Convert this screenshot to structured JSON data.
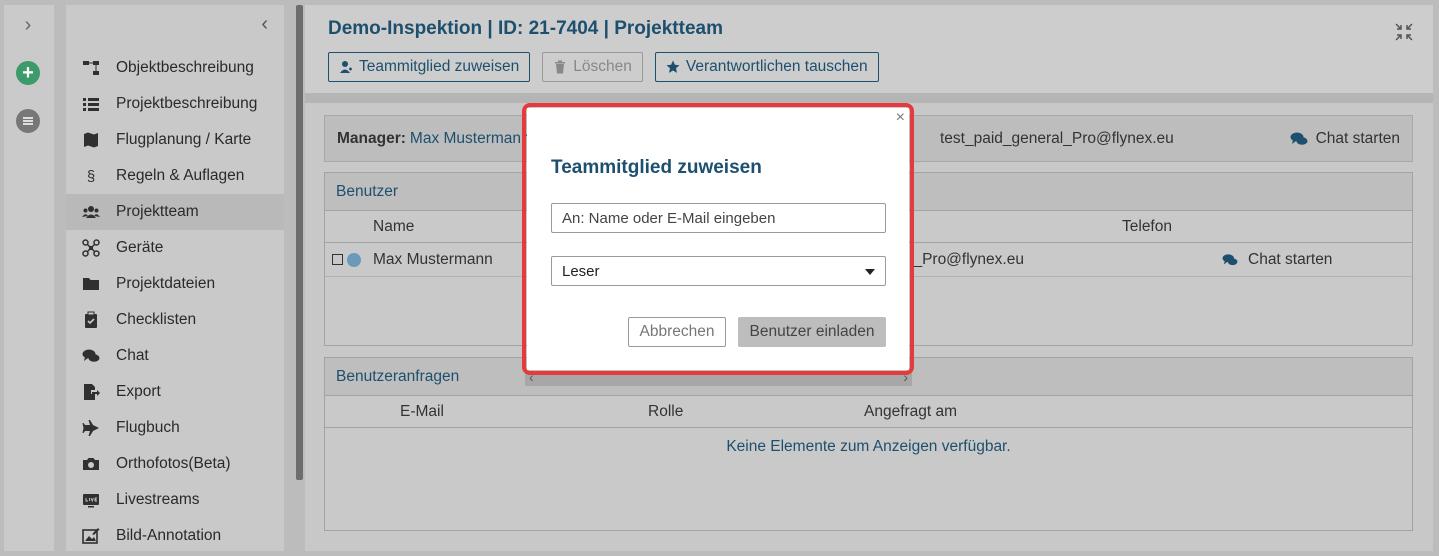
{
  "rail": {
    "expand_icon": "chevron-right-icon",
    "add_icon": "plus-circle-icon",
    "list_icon": "list-circle-icon"
  },
  "sidebar": {
    "collapse_icon": "chevron-left-icon",
    "items": [
      {
        "label": "Objektbeschreibung",
        "icon": "sitemap-icon"
      },
      {
        "label": "Projektbeschreibung",
        "icon": "list-icon"
      },
      {
        "label": "Flugplanung / Karte",
        "icon": "map-icon"
      },
      {
        "label": "Regeln & Auflagen",
        "icon": "paragraph-icon"
      },
      {
        "label": "Projektteam",
        "icon": "users-icon",
        "active": true
      },
      {
        "label": "Geräte",
        "icon": "drone-icon"
      },
      {
        "label": "Projektdateien",
        "icon": "folder-icon"
      },
      {
        "label": "Checklisten",
        "icon": "clipboard-icon"
      },
      {
        "label": "Chat",
        "icon": "chat-icon"
      },
      {
        "label": "Export",
        "icon": "export-icon"
      },
      {
        "label": "Flugbuch",
        "icon": "plane-icon"
      },
      {
        "label": "Orthofotos(Beta)",
        "icon": "camera-icon"
      },
      {
        "label": "Livestreams",
        "icon": "live-icon"
      },
      {
        "label": "Bild-Annotation",
        "icon": "image-edit-icon"
      }
    ]
  },
  "header": {
    "title": "Demo-Inspektion | ID: 21-7404 | Projektteam",
    "fullscreen_icon": "compress-icon",
    "toolbar": {
      "assign": "Teammitglied zuweisen",
      "delete": "Löschen",
      "swap": "Verantwortlichen tauschen"
    }
  },
  "manager": {
    "label": "Manager:",
    "name": "Max Mustermann",
    "email": "test_paid_general_Pro@flynex.eu",
    "chat": "Chat starten"
  },
  "users_panel": {
    "title": "Benutzer",
    "columns": {
      "name": "Name",
      "phone": "Telefon"
    },
    "rows": [
      {
        "name": "Max Mustermann",
        "email": "l_Pro@flynex.eu",
        "chat": "Chat starten"
      }
    ]
  },
  "requests_panel": {
    "title": "Benutzeranfragen",
    "columns": {
      "email": "E-Mail",
      "role": "Rolle",
      "requested": "Angefragt am"
    },
    "empty": "Keine Elemente zum Anzeigen verfügbar."
  },
  "modal": {
    "title": "Teammitglied zuweisen",
    "close": "×",
    "input_placeholder": "An: Name oder E-Mail eingeben",
    "role_selected": "Leser",
    "cancel": "Abbrechen",
    "invite": "Benutzer einladen",
    "highlight_color": "#e53b3b"
  },
  "colors": {
    "accent": "#1d4f6e",
    "add": "#3d9a6a"
  }
}
